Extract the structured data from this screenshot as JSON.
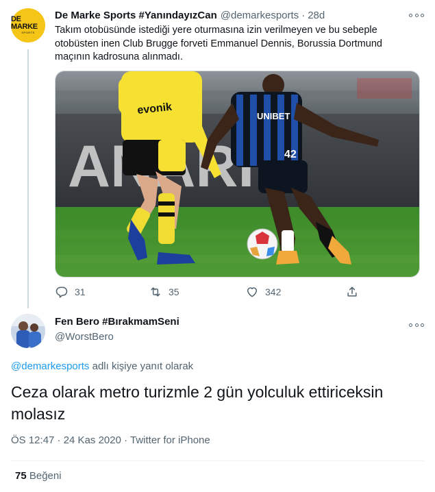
{
  "parent_tweet": {
    "avatar_logo_main": "DE MARKE",
    "avatar_logo_sub": "SPORTS",
    "display_name": "De Marke Sports #YanındayızCan",
    "handle": "@demarkesports",
    "separator": "·",
    "time": "28d",
    "text": "Takım otobüsünde istediği yere oturmasına izin verilmeyen ve bu sebeple otobüsten inen Club Brugge forveti Emmanuel Dennis, Borussia Dortmund maçının kadrosuna alınmadı.",
    "media": {
      "home_shirt_sponsor": "evonik",
      "away_shirt_sponsor": "UNIBET",
      "away_number": "42",
      "board_text": "ANARIY"
    },
    "actions": {
      "reply_count": "31",
      "retweet_count": "35",
      "like_count": "342"
    },
    "icons": [
      "more-icon",
      "reply-icon",
      "retweet-icon",
      "like-icon",
      "share-icon"
    ]
  },
  "reply_tweet": {
    "display_name": "Fen Bero #BırakmamSeni",
    "handle": "@WorstBero",
    "replying_to_handle": "@demarkesports",
    "replying_to_suffix": " adlı kişiye yanıt olarak",
    "text": "Ceza olarak metro turizmle 2 gün yolculuk ettiriceksin molasız",
    "meta": "ÖS 12:47 · 24 Kas 2020 · Twitter for iPhone",
    "like_count": "75",
    "like_label": " Beğeni"
  },
  "colors": {
    "accent": "#1d9bf0",
    "secondary_text": "#536471",
    "primary_text": "#0f1419",
    "avatar_yellow": "#f5c518",
    "pitch_green": "#3f8a2c",
    "bvb_yellow": "#f6e032",
    "brugge_blue": "#1f4fa8"
  }
}
